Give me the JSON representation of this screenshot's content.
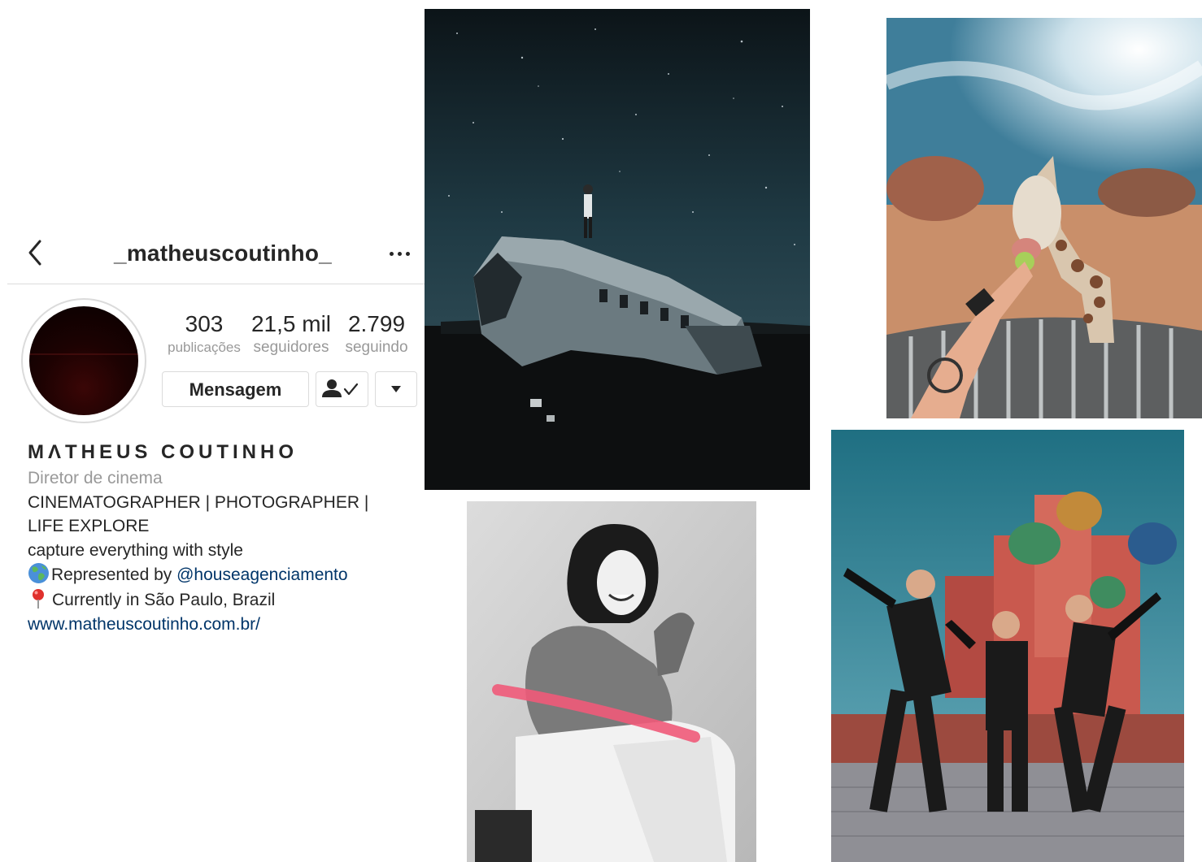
{
  "profile": {
    "username": "_matheuscoutinho_",
    "stats": [
      {
        "value": "303",
        "label": "publicações"
      },
      {
        "value": "21,5 mil",
        "label": "seguidores"
      },
      {
        "value": "2.799",
        "label": "seguindo"
      }
    ],
    "message_button": "Mensagem",
    "full_name": "MΛTHEUS COUTINHO",
    "category": "Diretor de cinema",
    "bio_lines": [
      "CINEMATOGRAPHER | PHOTOGRAPHER |",
      "LIFE EXPLORE",
      "capture everything with style"
    ],
    "represented_prefix": "Represented by ",
    "represented_mention": "@houseagenciamento",
    "location_text": "Currently in São Paulo, Brazil",
    "website": "www.matheuscoutinho.com.br/",
    "icons": {
      "back": "chevron-left-icon",
      "more": "more-horizontal-icon",
      "following": "person-check-icon",
      "dropdown": "caret-down-icon",
      "globe": "globe-emoji-icon",
      "pin": "pin-emoji-icon"
    },
    "colors": {
      "text": "#262626",
      "secondary": "#999999",
      "link": "#003569",
      "border": "#dbdbdb"
    }
  },
  "photos": [
    {
      "name": "plane-wreck-night-photo"
    },
    {
      "name": "giraffe-feeding-photo"
    },
    {
      "name": "woman-portrait-bw-photo"
    },
    {
      "name": "kremlin-group-photo"
    }
  ]
}
